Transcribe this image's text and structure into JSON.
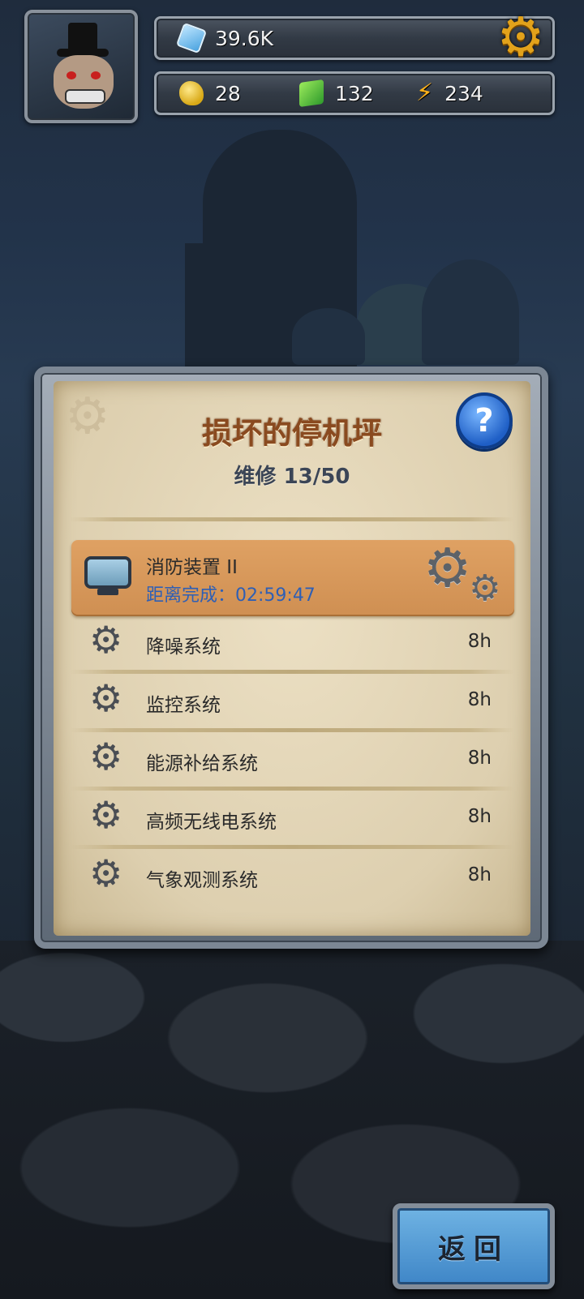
{
  "hud": {
    "crystals": "39.6K",
    "gold": "28",
    "cubes": "132",
    "energy": "234",
    "energy_symbol": "⚡",
    "settings_glyph": "⚙",
    "icons": [
      "crystal-icon",
      "gold-nugget-icon",
      "green-cube-icon",
      "lightning-icon",
      "settings-gear-icon"
    ]
  },
  "panel": {
    "title": "损坏的停机坪",
    "subtitle": "维修 13/50",
    "help_glyph": "?",
    "active": {
      "name": "消防装置 II",
      "countdown": "距离完成：02:59:47",
      "gear_glyph": "⚙"
    },
    "items": [
      {
        "label": "降噪系统",
        "time": "8h"
      },
      {
        "label": "监控系统",
        "time": "8h"
      },
      {
        "label": "能源补给系统",
        "time": "8h"
      },
      {
        "label": "高频无线电系统",
        "time": "8h"
      },
      {
        "label": "气象观测系统",
        "time": "8h"
      }
    ]
  },
  "footer": {
    "back_label": "返回"
  },
  "colors": {
    "title": "#8a4a1f",
    "subtitle": "#3b4556",
    "active_bg": "#d99a5c",
    "countdown": "#2e5fb5",
    "back_button": "#4f95d2",
    "settings_gear": "#e2a21b"
  }
}
